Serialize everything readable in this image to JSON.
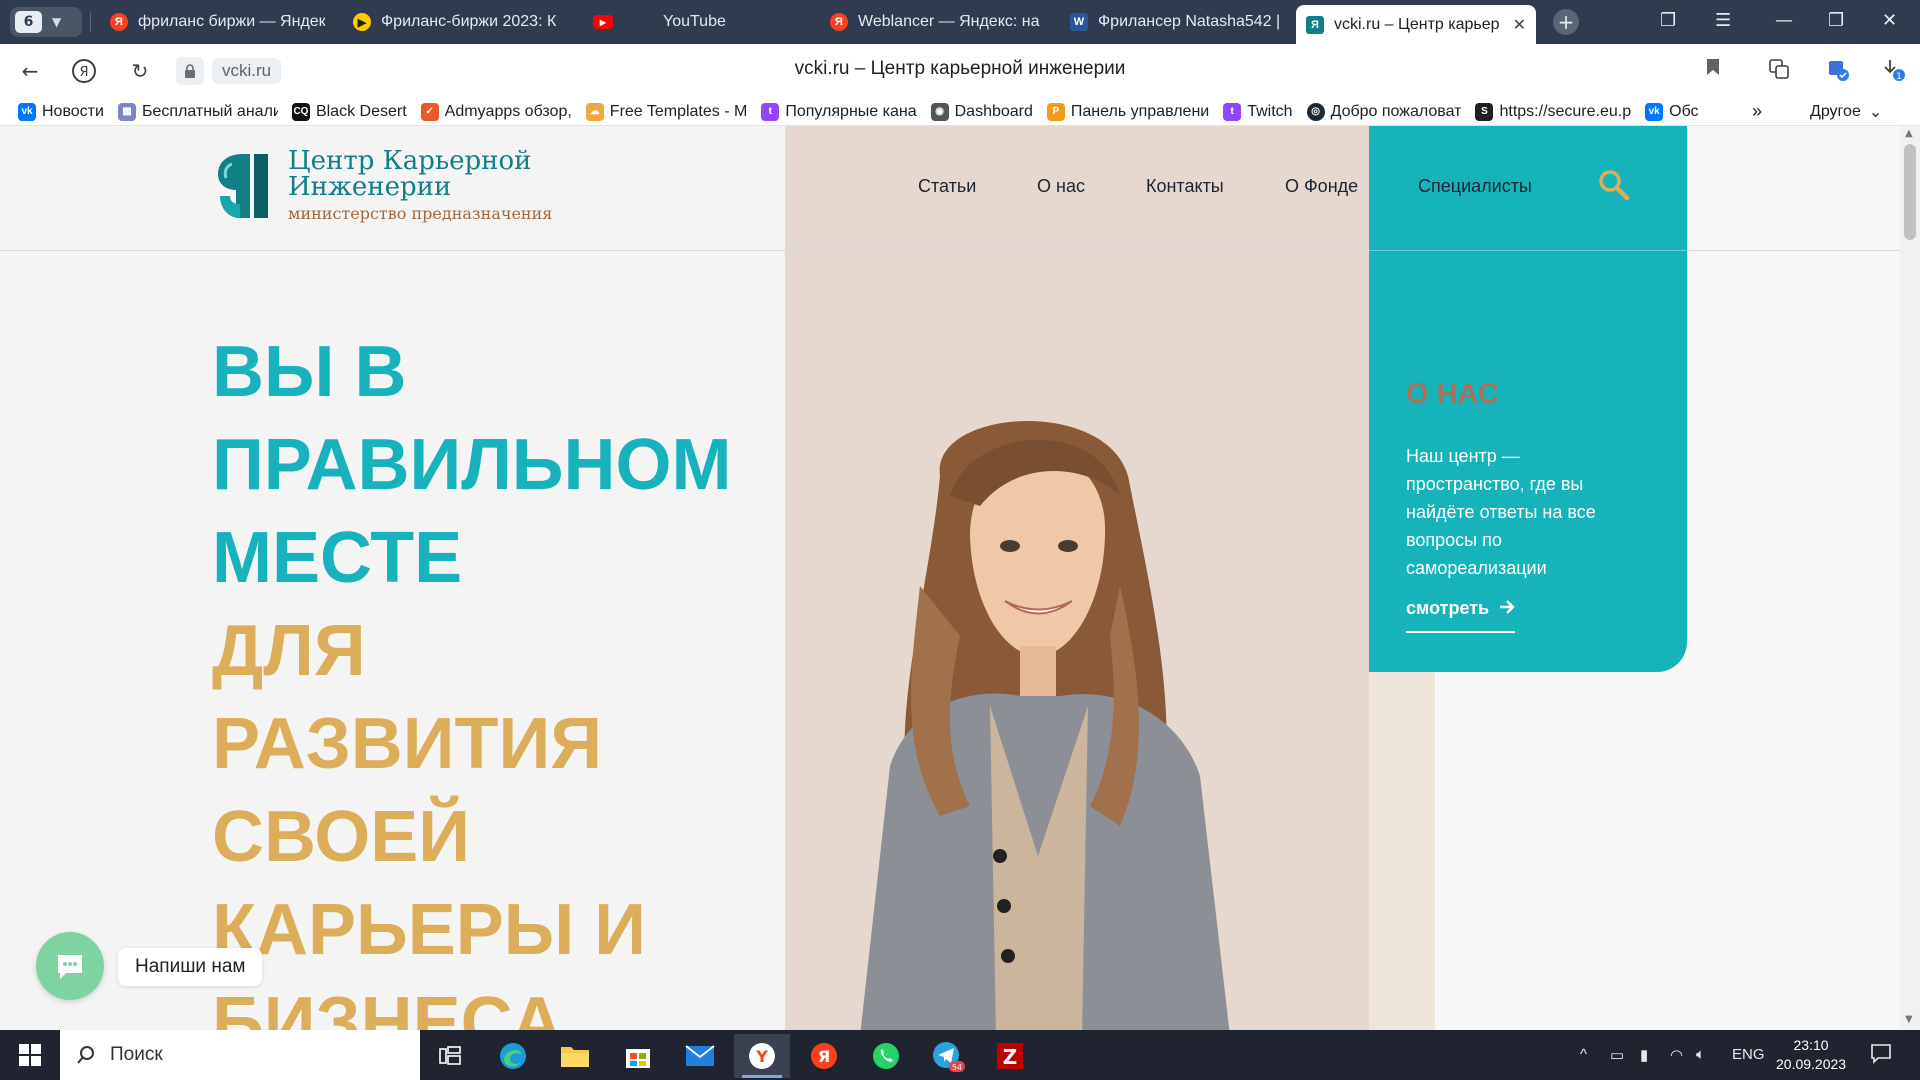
{
  "browser": {
    "tab_count": "6",
    "tabs": [
      {
        "title": "фриланс биржи — Яндекс",
        "favicon": "yandex-icon",
        "color": "#fc3f1d"
      },
      {
        "title": "Фриланс-биржи 2023: К",
        "favicon": "play-icon",
        "color": "#ffcc00"
      },
      {
        "title": "YouTube",
        "favicon": "youtube-icon",
        "color": "#ff0000"
      },
      {
        "title": "Weblancer — Яндекс: на",
        "favicon": "yandex-icon",
        "color": "#fc3f1d"
      },
      {
        "title": "Фрилансер Natasha542 |",
        "favicon": "word-icon",
        "color": "#2b579a"
      },
      {
        "title": "vcki.ru – Центр карьер",
        "favicon": "vcki-icon",
        "color": "#117f86"
      }
    ],
    "url": "vcki.ru",
    "page_title": "vcki.ru – Центр карьерной инженерии",
    "bookmarks": [
      {
        "label": "Новости",
        "color": "#0077ff",
        "icon": "vk-icon"
      },
      {
        "label": "Бесплатный анализ",
        "color": "#7e86c8",
        "icon": "grid-icon"
      },
      {
        "label": "Black Desert",
        "color": "#111111",
        "icon": "bd-icon"
      },
      {
        "label": "Admyapps обзор,",
        "color": "#e85a2a",
        "icon": "check-icon"
      },
      {
        "label": "Free Templates - M",
        "color": "#f0a83c",
        "icon": "cloud-icon"
      },
      {
        "label": "Популярные кана",
        "color": "#9146ff",
        "icon": "twitch-icon"
      },
      {
        "label": "Dashboard",
        "color": "#555555",
        "icon": "chat-icon"
      },
      {
        "label": "Панель управлени",
        "color": "#f29c1f",
        "icon": "p-icon"
      },
      {
        "label": "Twitch",
        "color": "#9146ff",
        "icon": "twitch-icon"
      },
      {
        "label": "Добро пожаловат",
        "color": "#1b2838",
        "icon": "steam-icon"
      },
      {
        "label": "https://secure.eu.p",
        "color": "#222222",
        "icon": "s-icon"
      },
      {
        "label": "Обс",
        "color": "#0077ff",
        "icon": "vk-icon"
      }
    ],
    "bookmarks_more": "»",
    "bookmarks_other": "Другое"
  },
  "site": {
    "logo_title_1": "Центр Карьерной",
    "logo_title_2": "Инженерии",
    "logo_subtitle": "министерство предназначения",
    "nav": [
      "Статьи",
      "О нас",
      "Контакты",
      "О Фонде",
      "Специалисты"
    ],
    "hero_teal": [
      "ВЫ В",
      "ПРАВИЛЬНОМ",
      "МЕСТЕ"
    ],
    "hero_gold": [
      "ДЛЯ",
      "РАЗВИТИЯ",
      "СВОЕЙ",
      "КАРЬЕРЫ И",
      "БИЗНЕСА"
    ],
    "card": {
      "heading": "О НАС",
      "text": "Наш центр — пространство, где вы найдёте ответы на все вопросы по самореализации",
      "link": "смотреть"
    },
    "chat_label": "Напиши нам",
    "colors": {
      "teal": "#17b2bb",
      "gold": "#dcae5a",
      "brown": "#a7715a"
    }
  },
  "taskbar": {
    "search_placeholder": "Поиск",
    "lang": "ENG",
    "time": "23:10",
    "date": "20.09.2023",
    "telegram_badge": "54"
  }
}
